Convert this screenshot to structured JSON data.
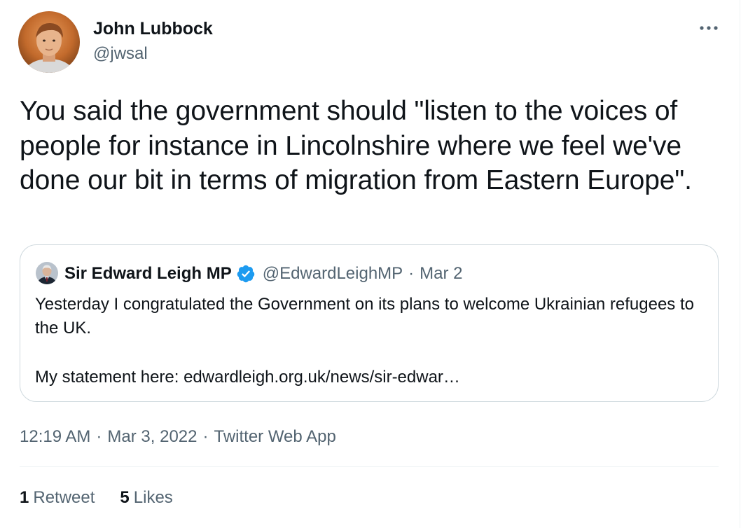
{
  "author": {
    "name": "John Lubbock",
    "handle": "@jwsal",
    "avatar_icon": "profile-photo"
  },
  "more_icon": "more-horizontal-icon",
  "tweet": {
    "text": "You said the government should \"listen to the voices of people for instance in Lincolnshire where we feel we've done our bit in terms of migration from Eastern Europe\"."
  },
  "quoted": {
    "name": "Sir Edward Leigh MP",
    "verified": true,
    "handle": "@EdwardLeighMP",
    "separator": "·",
    "date": "Mar 2",
    "paragraph1": "Yesterday I congratulated the Government on its plans to welcome Ukrainian refugees to the UK.",
    "paragraph2": "My statement here: edwardleigh.org.uk/news/sir-edwar…"
  },
  "meta": {
    "time": "12:19 AM",
    "separator": "·",
    "date": "Mar 3, 2022",
    "source": "Twitter Web App"
  },
  "stats": {
    "retweets_count": "1",
    "retweets_label": "Retweet",
    "likes_count": "5",
    "likes_label": "Likes"
  },
  "colors": {
    "text_primary": "#0f1419",
    "text_secondary": "#536471",
    "border": "#cfd9de",
    "divider": "#eff3f4",
    "verified_blue": "#1d9bf0"
  }
}
